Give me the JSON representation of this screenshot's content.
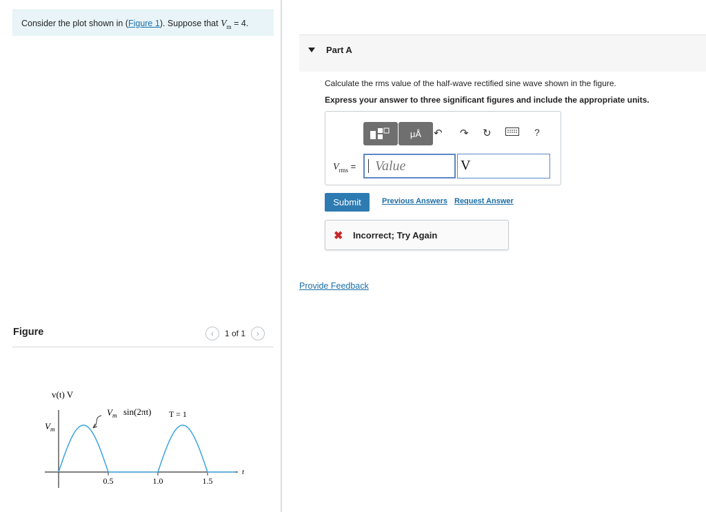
{
  "intro": {
    "prefix": "Consider the plot shown in (",
    "link": "Figure 1",
    "mid": "). Suppose that ",
    "var": "V",
    "sub": "m",
    "suffix": " = 4."
  },
  "figure": {
    "title": "Figure",
    "pager": "1 of 1",
    "plot": {
      "y_label": "v(t) V",
      "vm_label": "V",
      "vm_sub": "m",
      "curve_label": "sin(2πt)",
      "period_label": "T = 1",
      "x_axis_label": "t",
      "ticks": [
        "0.5",
        "1.0",
        "1.5"
      ],
      "curve_color": "#45a7e0"
    }
  },
  "part": {
    "label": "Part A",
    "question": "Calculate the rms value of the half-wave rectified sine wave shown in the figure.",
    "instruction": "Express your answer to three significant figures and include the appropriate units.",
    "toolbar": {
      "units_button": "μÅ",
      "help": "?"
    },
    "variable": "V",
    "variable_sub": "rms",
    "equals": " =",
    "value_placeholder": "Value",
    "unit_value": "V",
    "submit": "Submit",
    "previous_answers": "Previous Answers",
    "request_answer": "Request Answer",
    "feedback": "Incorrect; Try Again"
  },
  "provide_feedback": "Provide Feedback",
  "colors": {
    "accent": "#2e7bb2",
    "link": "#1a6ea8",
    "error": "#c62828",
    "intro_bg": "#e8f4f8"
  }
}
